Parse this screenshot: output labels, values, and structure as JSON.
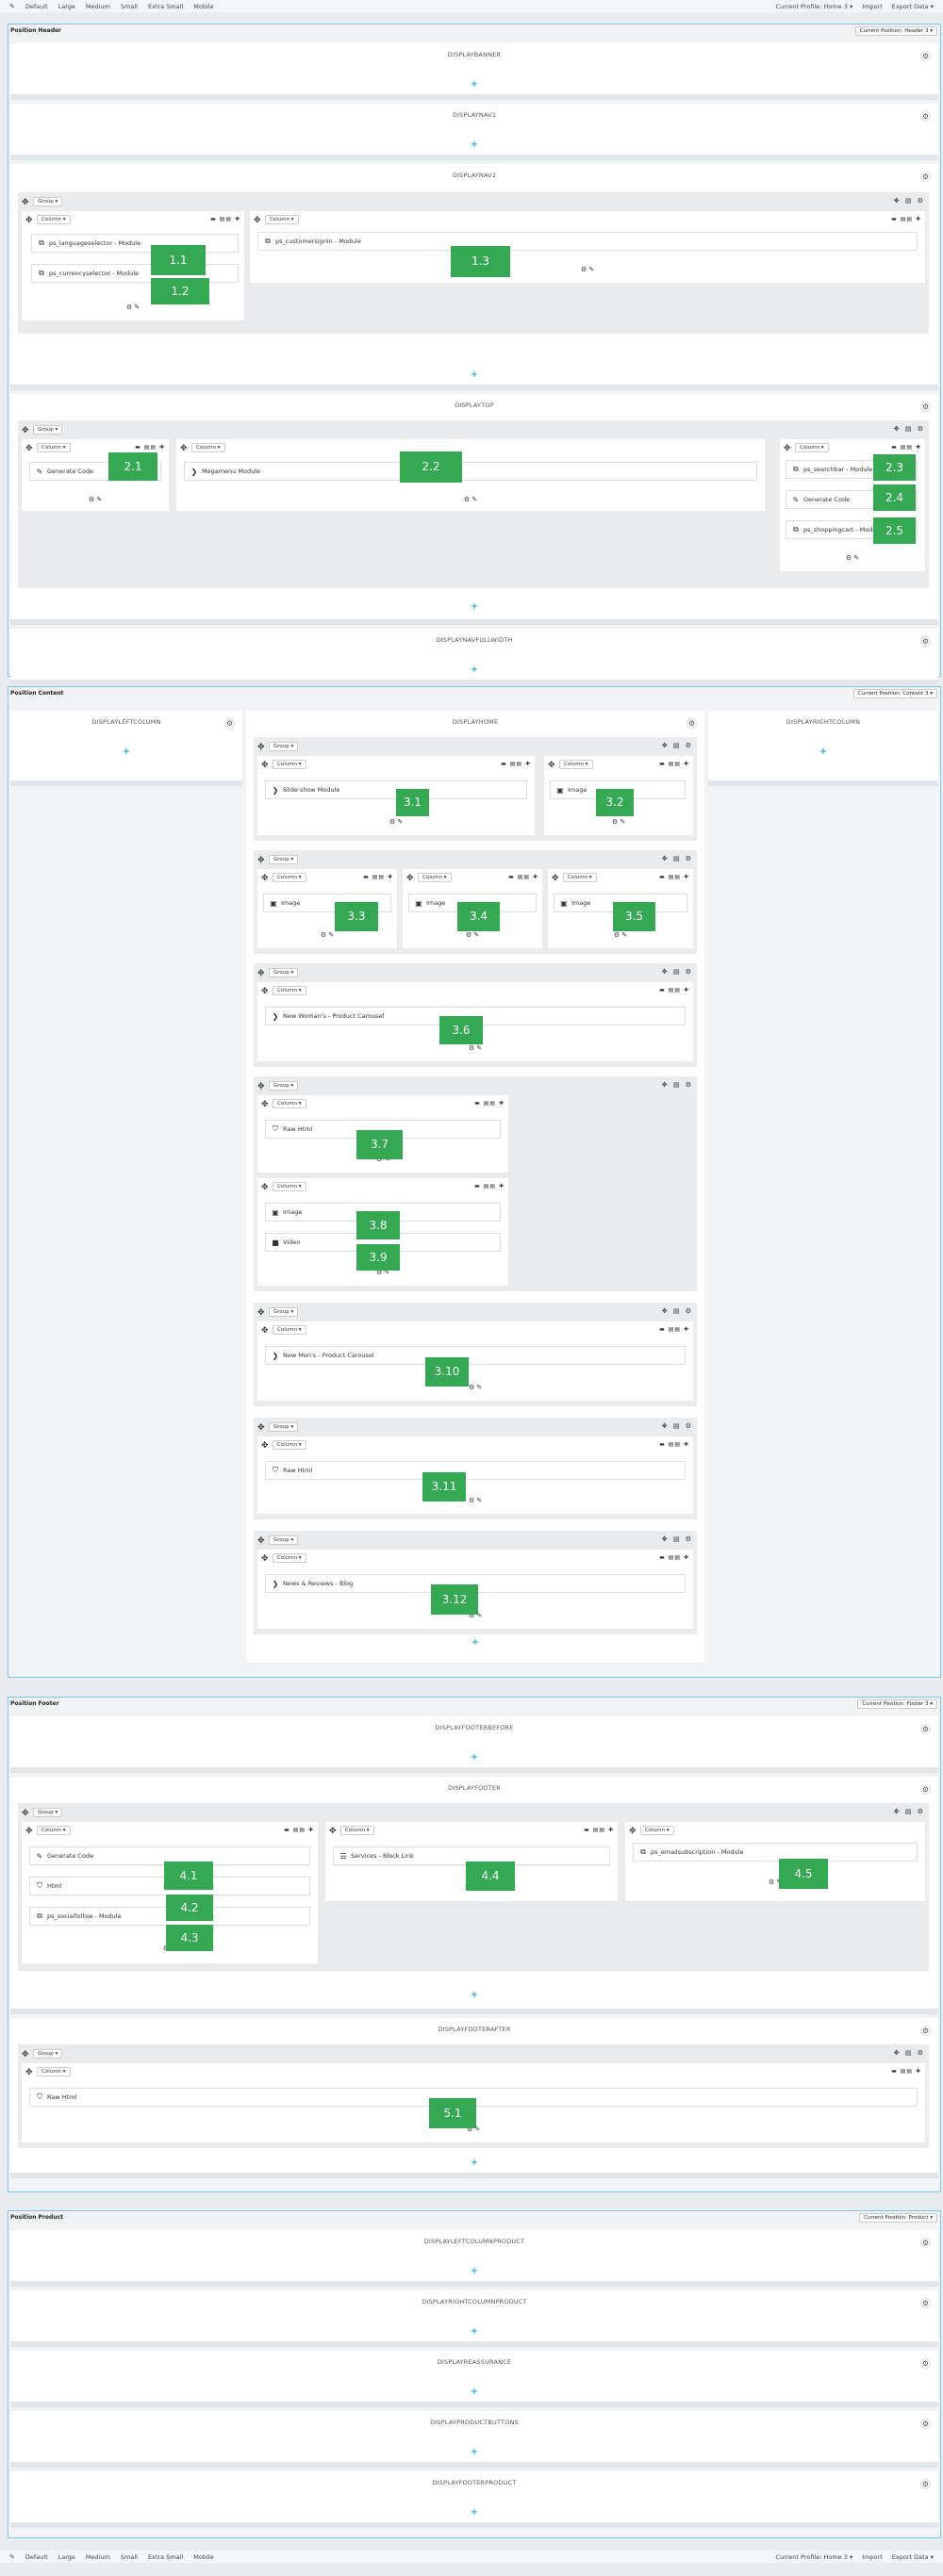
{
  "toolbar": {
    "pen": "✎",
    "devices": [
      "Default",
      "Large",
      "Medium",
      "Small",
      "Extra Small",
      "Mobile"
    ],
    "profile": "Current Profile: Home 3 ▾",
    "import": "Import",
    "export": "Export Data ▾"
  },
  "positions": {
    "header": {
      "title": "Position Header",
      "select": "Current Position: Header 3 ▾"
    },
    "content": {
      "title": "Position Content",
      "select": "Current Position: Content 3 ▾"
    },
    "footer": {
      "title": "Position Footer",
      "select": "Current Position: Footer 3 ▾"
    },
    "product": {
      "title": "Position Product",
      "select": "Current Position: Product ▾"
    }
  },
  "hooks": {
    "displaybanner": "DISPLAYBANNER",
    "displaynav1": "DISPLAYNAV1",
    "displaynav2": "DISPLAYNAV2",
    "displaytop": "DISPLAYTOP",
    "displaynavfullwidth": "DISPLAYNAVFULLWIDTH",
    "displayleftcolumn": "DISPLAYLEFTCOLUMN",
    "displayhome": "DISPLAYHOME",
    "displayrightcolumn": "DISPLAYRIGHTCOLUMN",
    "displayfooterbefore": "DISPLAYFOOTERBEFORE",
    "displayfooter": "DISPLAYFOOTER",
    "displayfooterafter": "DISPLAYFOOTERAFTER",
    "displayleftcolumnproduct": "DISPLAYLEFTCOLUMNPRODUCT",
    "displayrightcolumnproduct": "DISPLAYRIGHTCOLUMNPRODUCT",
    "displayreassurance": "DISPLAYREASSURANCE",
    "displayproductbuttons": "DISPLAYPRODUCTBUTTONS",
    "displayfooterproduct": "DISPLAYFOOTERPRODUCT"
  },
  "labels": {
    "group": "Group ▾",
    "column": "Column ▾",
    "add": "+",
    "gear": "⚙",
    "move": "✥",
    "group_tools": "✥ ▤ ⚙",
    "column_tools": "▬ ▤▤ ✚",
    "col_foot": "⚙ ✎"
  },
  "modules": {
    "m1_1": "ps_languageselector - Module",
    "m1_2": "ps_currencyselector - Module",
    "m1_3": "ps_customersignin - Module",
    "m2_1": "Generate Code",
    "m2_2": "Megamenu Module",
    "m2_3": "ps_searchbar - Module",
    "m2_4": "Generate Code",
    "m2_5": "ps_shoppingcart - Module",
    "m3_1": "Slide show Module",
    "m3_2": "Image",
    "m3_3": "Image",
    "m3_4": "Image",
    "m3_5": "Image",
    "m3_6": "New Woman's - Product Carousel",
    "m3_7": "Raw Html",
    "m3_8": "Image",
    "m3_9": "Video",
    "m3_10": "New Men's - Product Carousel",
    "m3_11": "Raw Html",
    "m3_12": "News & Reviews - Blog",
    "m4_1": "Generate Code",
    "m4_2": "Html",
    "m4_3": "ps_socialfollow - Module",
    "m4_4": "Services - Block Link",
    "m4_5": "ps_emailsubscription - Module",
    "m5_1": "Raw Html"
  },
  "badges": {
    "b1_1": "1.1",
    "b1_2": "1.2",
    "b1_3": "1.3",
    "b2_1": "2.1",
    "b2_2": "2.2",
    "b2_3": "2.3",
    "b2_4": "2.4",
    "b2_5": "2.5",
    "b3_1": "3.1",
    "b3_2": "3.2",
    "b3_3": "3.3",
    "b3_4": "3.4",
    "b3_5": "3.5",
    "b3_6": "3.6",
    "b3_7": "3.7",
    "b3_8": "3.8",
    "b3_9": "3.9",
    "b3_10": "3.10",
    "b3_11": "3.11",
    "b3_12": "3.12",
    "b4_1": "4.1",
    "b4_2": "4.2",
    "b4_3": "4.3",
    "b4_4": "4.4",
    "b4_5": "4.5",
    "b5_1": "5.1"
  }
}
